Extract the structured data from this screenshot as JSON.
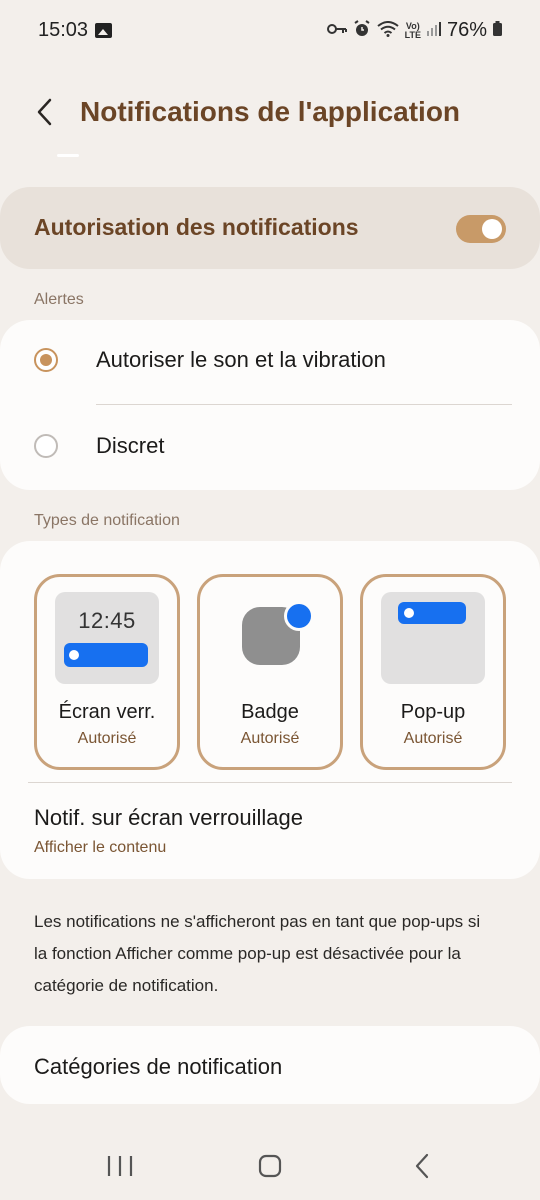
{
  "status_bar": {
    "time": "15:03",
    "battery": "76%",
    "icons": [
      "image-icon",
      "key-icon",
      "alarm-icon",
      "wifi-icon",
      "volte-icon",
      "signal-icon",
      "battery-icon"
    ]
  },
  "header": {
    "title": "Notifications de l'application"
  },
  "master": {
    "label": "Autorisation des notifications",
    "enabled": true
  },
  "alerts": {
    "section_label": "Alertes",
    "options": [
      {
        "label": "Autoriser le son et la vibration",
        "selected": true
      },
      {
        "label": "Discret",
        "selected": false
      }
    ]
  },
  "types": {
    "section_label": "Types de notification",
    "items": [
      {
        "title": "Écran verr.",
        "status": "Autorisé",
        "preview_time": "12:45"
      },
      {
        "title": "Badge",
        "status": "Autorisé"
      },
      {
        "title": "Pop-up",
        "status": "Autorisé"
      }
    ]
  },
  "lock_screen": {
    "title": "Notif. sur écran verrouillage",
    "value": "Afficher le contenu"
  },
  "info": "Les notifications ne s'afficheront pas en tant que pop-ups si la fonction Afficher comme pop-up est désactivée pour la catégorie de notification.",
  "categories": {
    "label": "Catégories de notification"
  },
  "colors": {
    "accent": "#c89a68",
    "title_brown": "#6b4526",
    "blue": "#1770f0",
    "background": "#f3efeb"
  }
}
